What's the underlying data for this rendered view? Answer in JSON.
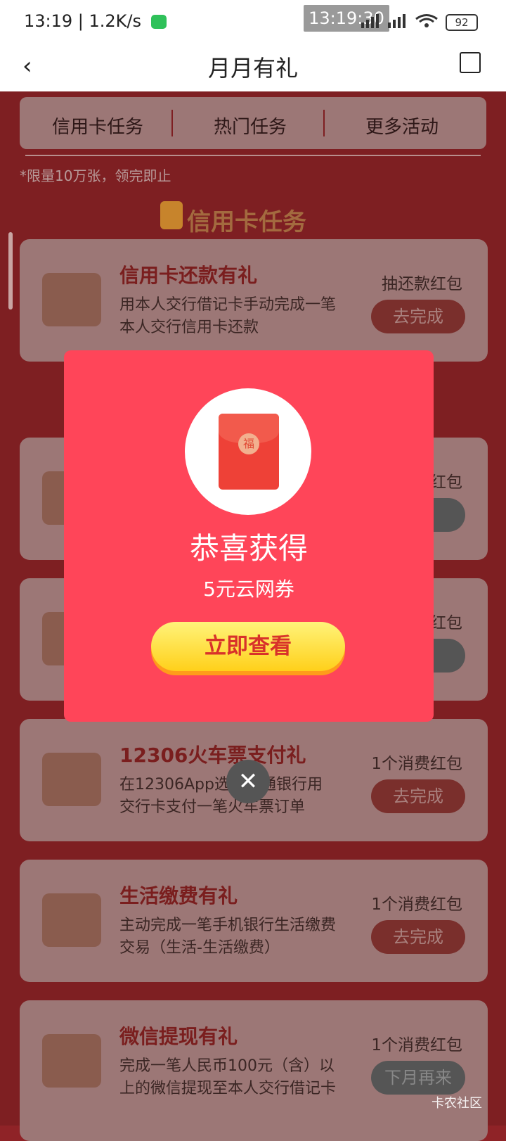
{
  "status": {
    "left_text": "13:19 | 1.2K/s",
    "center_clock": "13:19:30",
    "battery": "92"
  },
  "appbar": {
    "title": "月月有礼"
  },
  "tabs": [
    {
      "label": "信用卡任务"
    },
    {
      "label": "热门任务"
    },
    {
      "label": "更多活动"
    }
  ],
  "notice": "*限量10万张，领完即止",
  "section": {
    "title": "信用卡任务"
  },
  "cards": [
    {
      "title": "信用卡还款有礼",
      "desc": "用本人交行借记卡手动完成一笔本人交行信用卡还款",
      "reward": "抽还款红包",
      "button": "去完成",
      "button_state": "active"
    },
    {
      "title": "",
      "desc": "",
      "reward": "红包",
      "button": "来",
      "button_state": "disabled"
    },
    {
      "title": "",
      "desc": "",
      "reward": "红包",
      "button": "来",
      "button_state": "disabled"
    },
    {
      "title": "12306火车票支付礼",
      "desc": "在12306App选择交通银行用交行卡支付一笔火车票订单",
      "reward": "1个消费红包",
      "button": "去完成",
      "button_state": "active"
    },
    {
      "title": "生活缴费有礼",
      "desc": "主动完成一笔手机银行生活缴费交易（生活-生活缴费）",
      "reward": "1个消费红包",
      "button": "去完成",
      "button_state": "active"
    },
    {
      "title": "微信提现有礼",
      "desc": "完成一笔人民币100元（含）以上的微信提现至本人交行借记卡",
      "reward": "1个消费红包",
      "button": "下月再来",
      "button_state": "disabled"
    }
  ],
  "modal": {
    "seal_char": "福",
    "title": "恭喜获得",
    "subtitle": "5元云网券",
    "button": "立即查看"
  },
  "watermark": "卡农社区"
}
